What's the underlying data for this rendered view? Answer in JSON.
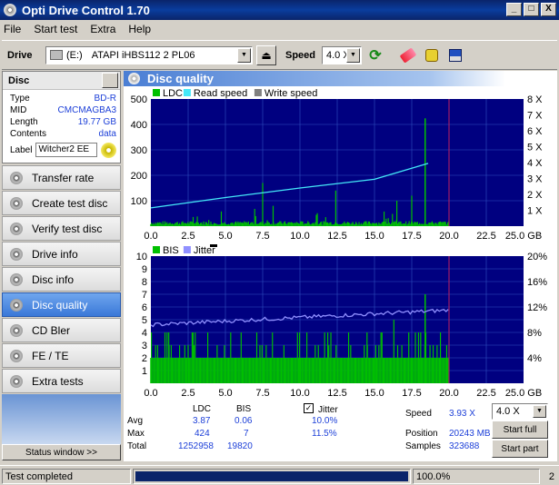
{
  "window": {
    "title": "Opti Drive Control 1.70",
    "min": "_",
    "max": "□",
    "close": "X"
  },
  "menu": [
    "File",
    "Start test",
    "Extra",
    "Help"
  ],
  "toolbar": {
    "drive_label": "Drive",
    "drive_letter": "(E:)",
    "drive_name": "ATAPI iHBS112   2 PL06",
    "speed_label": "Speed",
    "speed_value": "4.0 X"
  },
  "disc": {
    "header": "Disc",
    "type_label": "Type",
    "type": "BD-R",
    "mid_label": "MID",
    "mid": "CMCMAGBA3",
    "length_label": "Length",
    "length": "19.77 GB",
    "contents_label": "Contents",
    "contents": "data",
    "label_label": "Label",
    "label": "Witcher2 EE"
  },
  "nav": [
    "Transfer rate",
    "Create test disc",
    "Verify test disc",
    "Drive info",
    "Disc info",
    "Disc quality",
    "CD Bler",
    "FE / TE",
    "Extra tests"
  ],
  "nav_active": "Disc quality",
  "status_window": "Status window >>",
  "panel_title": "Disc quality",
  "chart1": {
    "legend": [
      "LDC",
      "Read speed",
      "Write speed"
    ],
    "yticks": [
      "500",
      "400",
      "300",
      "200",
      "100"
    ],
    "y2ticks": [
      "8 X",
      "7 X",
      "6 X",
      "5 X",
      "4 X",
      "3 X",
      "2 X",
      "1 X"
    ],
    "xticks": [
      "0.0",
      "2.5",
      "5.0",
      "7.5",
      "10.0",
      "12.5",
      "15.0",
      "17.5",
      "20.0",
      "22.5",
      "25.0 GB"
    ]
  },
  "chart2": {
    "legend": [
      "BIS",
      "Jitter"
    ],
    "yticks": [
      "10",
      "9",
      "8",
      "7",
      "6",
      "5",
      "4",
      "3",
      "2",
      "1"
    ],
    "y2ticks": [
      "20%",
      "16%",
      "12%",
      "8%",
      "4%"
    ],
    "xticks": [
      "0.0",
      "2.5",
      "5.0",
      "7.5",
      "10.0",
      "12.5",
      "15.0",
      "17.5",
      "20.0",
      "22.5",
      "25.0 GB"
    ]
  },
  "colors": {
    "ldc": "#00c000",
    "read": "#44e8f8",
    "write": "#808080",
    "bis": "#00c000",
    "jitter": "#9090ff",
    "plot_bg": "#000080"
  },
  "chart_data": [
    {
      "type": "area",
      "title": "",
      "series": [
        {
          "name": "LDC",
          "x": [
            0,
            2.5,
            5,
            7.5,
            10,
            12.5,
            15,
            17.5,
            18.4,
            20
          ],
          "values": [
            8,
            10,
            9,
            12,
            10,
            10,
            11,
            14,
            424,
            0
          ]
        },
        {
          "name": "Read speed",
          "x": [
            0,
            5,
            10,
            15,
            18.6
          ],
          "values": [
            1.15,
            1.8,
            2.4,
            2.95,
            3.95
          ]
        }
      ],
      "xlim": [
        0,
        25
      ],
      "ylim": [
        0,
        500
      ],
      "y2lim": [
        0,
        8
      ]
    },
    {
      "type": "area",
      "title": "",
      "series": [
        {
          "name": "BIS",
          "x": [
            0,
            5,
            10,
            15,
            18.4,
            20
          ],
          "values": [
            2,
            2,
            2,
            2,
            7,
            0
          ]
        },
        {
          "name": "Jitter",
          "x": [
            0,
            5,
            10,
            15,
            20
          ],
          "values": [
            9.2,
            9.6,
            10.4,
            11.0,
            11.5
          ]
        }
      ],
      "xlim": [
        0,
        25
      ],
      "ylim": [
        0,
        10
      ],
      "y2lim": [
        0,
        20
      ]
    }
  ],
  "stats": {
    "col_ldc": "LDC",
    "col_bis": "BIS",
    "jitter_label": "Jitter",
    "avg_label": "Avg",
    "max_label": "Max",
    "total_label": "Total",
    "avg_ldc": "3.87",
    "avg_bis": "0.06",
    "avg_jitter": "10.0%",
    "max_ldc": "424",
    "max_bis": "7",
    "max_jitter": "11.5%",
    "total_ldc": "1252958",
    "total_bis": "19820",
    "speed_label": "Speed",
    "speed": "3.93 X",
    "position_label": "Position",
    "position": "20243 MB",
    "samples_label": "Samples",
    "samples": "323688",
    "speed_select": "4.0 X",
    "start_full": "Start full",
    "start_part": "Start part"
  },
  "statusbar": {
    "text": "Test completed",
    "progress": 1.0,
    "percent": "100.0%",
    "right": "2"
  }
}
